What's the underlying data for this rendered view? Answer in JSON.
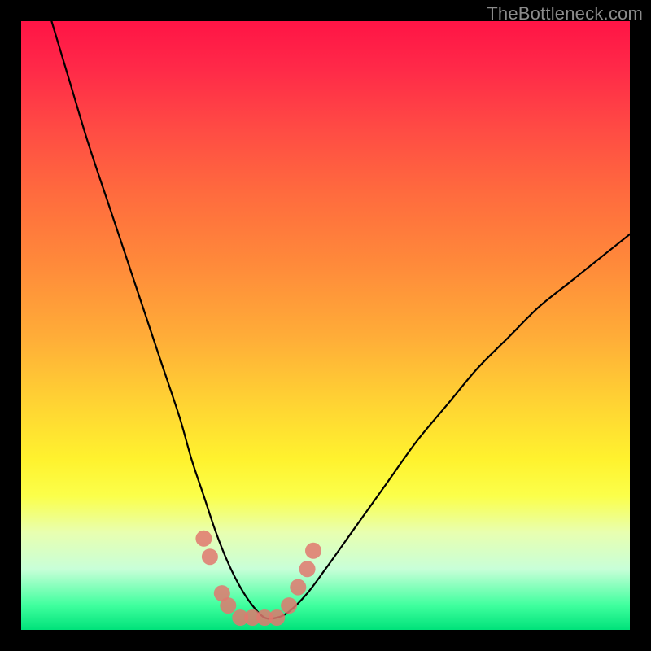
{
  "watermark": {
    "text": "TheBottleneck.com"
  },
  "chart_data": {
    "type": "line",
    "title": "",
    "xlabel": "",
    "ylabel": "",
    "xlim": [
      0,
      100
    ],
    "ylim": [
      0,
      100
    ],
    "grid": false,
    "series": [
      {
        "name": "bottleneck-curve",
        "x": [
          5,
          8,
          11,
          14,
          17,
          20,
          23,
          26,
          28,
          30,
          32,
          34,
          36,
          38,
          40,
          42,
          44,
          47,
          50,
          55,
          60,
          65,
          70,
          75,
          80,
          85,
          90,
          95,
          100
        ],
        "y": [
          100,
          90,
          80,
          71,
          62,
          53,
          44,
          35,
          28,
          22,
          16,
          11,
          7,
          4,
          2,
          2,
          3,
          6,
          10,
          17,
          24,
          31,
          37,
          43,
          48,
          53,
          57,
          61,
          65
        ]
      }
    ],
    "markers": {
      "name": "highlight-dots",
      "color": "#e0786f",
      "points": [
        {
          "x": 30,
          "y": 15
        },
        {
          "x": 31,
          "y": 12
        },
        {
          "x": 33,
          "y": 6
        },
        {
          "x": 34,
          "y": 4
        },
        {
          "x": 36,
          "y": 2
        },
        {
          "x": 38,
          "y": 2
        },
        {
          "x": 40,
          "y": 2
        },
        {
          "x": 42,
          "y": 2
        },
        {
          "x": 44,
          "y": 4
        },
        {
          "x": 45.5,
          "y": 7
        },
        {
          "x": 47,
          "y": 10
        },
        {
          "x": 48,
          "y": 13
        }
      ]
    },
    "background_gradient": {
      "stops": [
        {
          "pos": 0.0,
          "color": "#ff1446"
        },
        {
          "pos": 0.5,
          "color": "#ffad38"
        },
        {
          "pos": 0.75,
          "color": "#fff22e"
        },
        {
          "pos": 1.0,
          "color": "#00e27a"
        }
      ]
    }
  }
}
